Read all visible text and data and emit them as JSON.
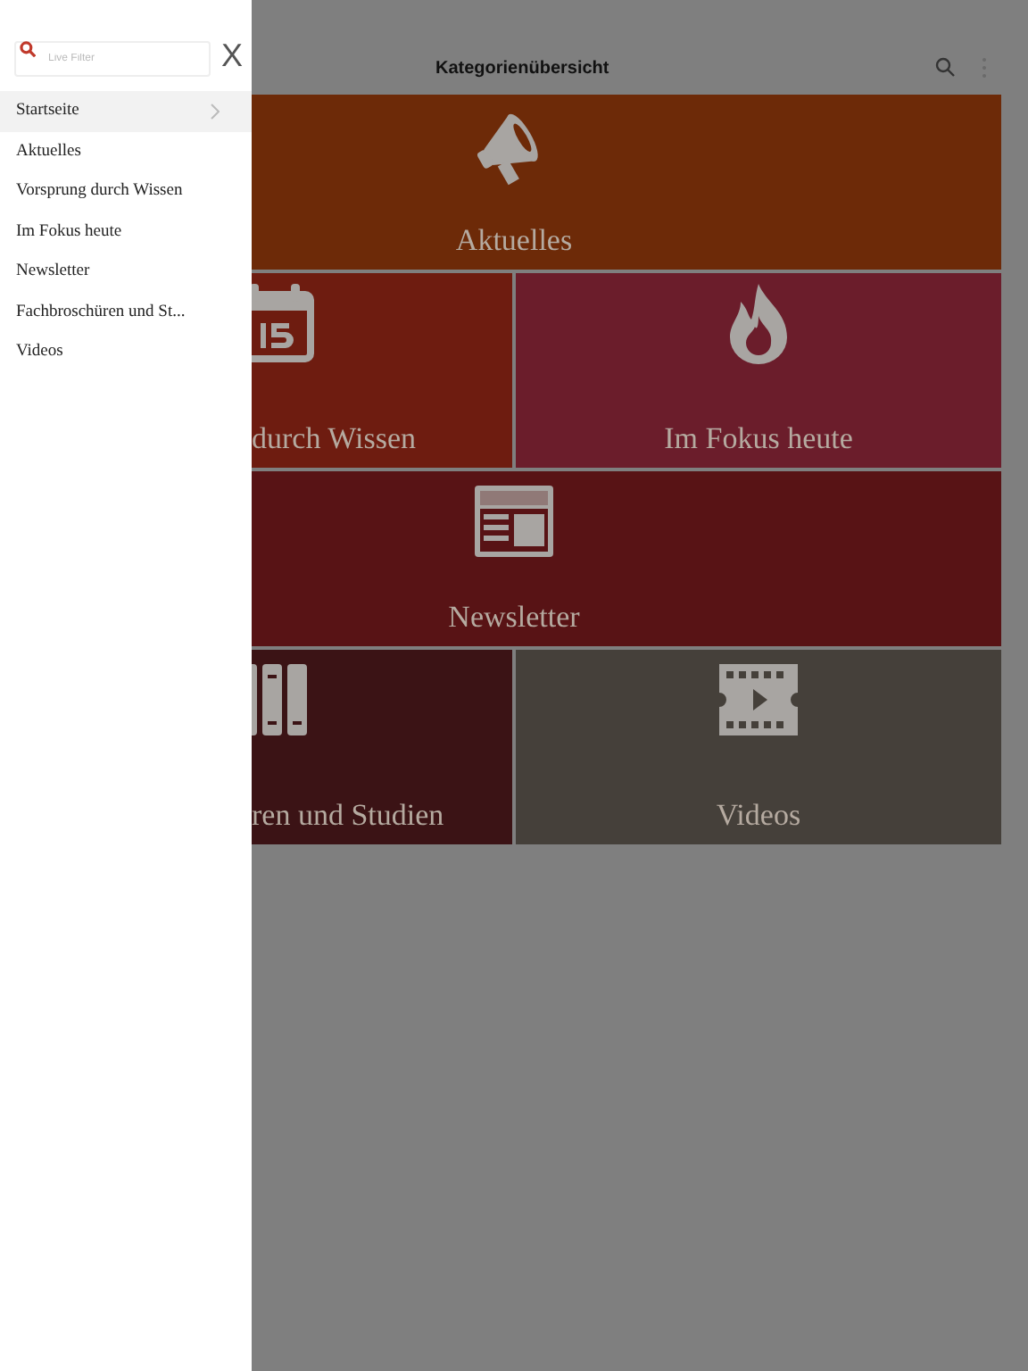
{
  "header": {
    "title": "Kategorienübersicht"
  },
  "tiles": [
    {
      "label": "Aktuelles",
      "kind": "megaphone",
      "wide": true,
      "color": "#6d2a08"
    },
    {
      "label": "durch Wissen",
      "kind": "calendar",
      "wide": false,
      "color": "#6e1c10"
    },
    {
      "label": "Im Fokus heute",
      "kind": "flame",
      "wide": false,
      "color": "#6b1d2b"
    },
    {
      "label": "Newsletter",
      "kind": "news",
      "wide": true,
      "color": "#581315"
    },
    {
      "label": "ren und Studien",
      "kind": "books",
      "wide": false,
      "color": "#3b1315"
    },
    {
      "label": "Videos",
      "kind": "film",
      "wide": false,
      "color": "#45403a"
    }
  ],
  "drawer": {
    "search": {
      "placeholder": "Live Filter"
    },
    "close": "X",
    "items": [
      {
        "label": "Startseite",
        "selected": true
      },
      {
        "label": "Aktuelles",
        "selected": false
      },
      {
        "label": "Vorsprung durch Wissen",
        "selected": false
      },
      {
        "label": "Im Fokus heute",
        "selected": false
      },
      {
        "label": "Newsletter",
        "selected": false
      },
      {
        "label": "Fachbroschüren und St...",
        "selected": false
      },
      {
        "label": "Videos",
        "selected": false
      }
    ]
  }
}
